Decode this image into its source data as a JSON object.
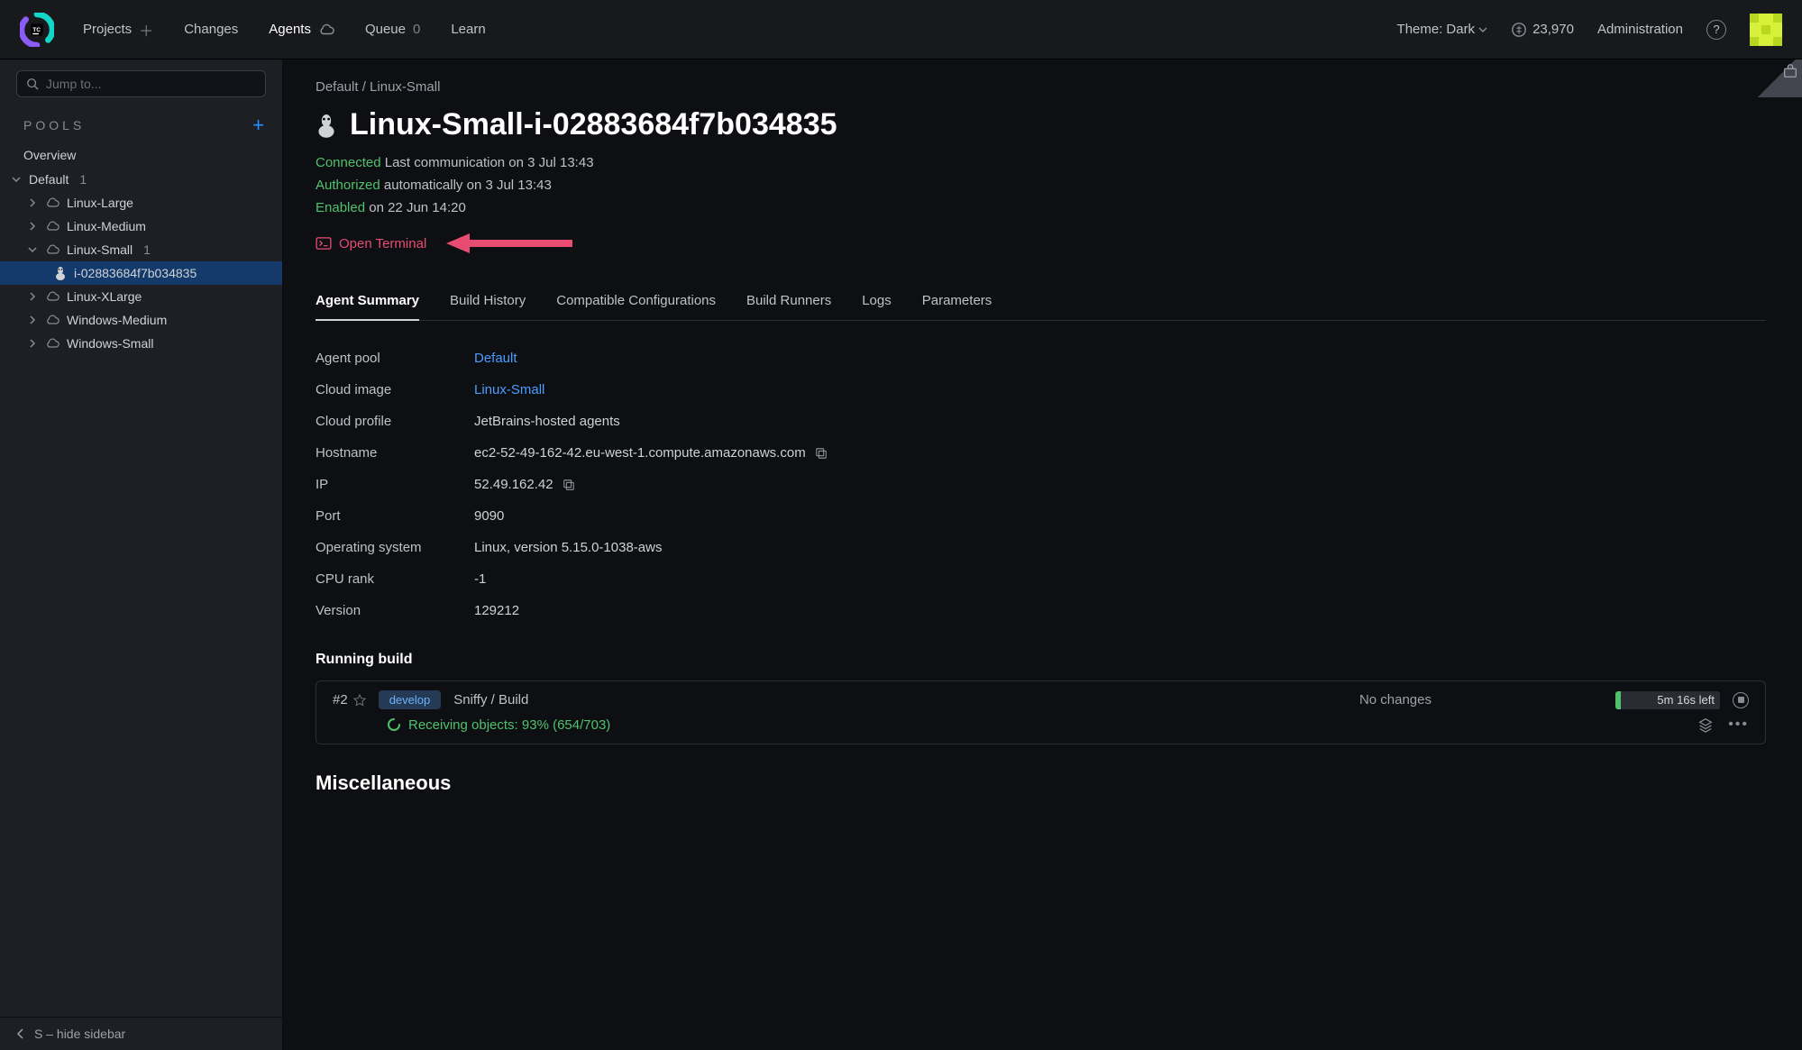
{
  "header": {
    "nav": {
      "projects": "Projects",
      "changes": "Changes",
      "agents": "Agents",
      "queue": "Queue",
      "queue_count": "0",
      "learn": "Learn"
    },
    "theme_label": "Theme:",
    "theme_value": "Dark",
    "credits": "23,970",
    "administration": "Administration"
  },
  "sidebar": {
    "search_placeholder": "Jump to...",
    "pools_label": "POOLS",
    "overview": "Overview",
    "hide_hint": "S – hide sidebar",
    "default_label": "Default",
    "default_count": "1",
    "items": [
      {
        "label": "Linux-Large"
      },
      {
        "label": "Linux-Medium"
      },
      {
        "label": "Linux-Small",
        "count": "1"
      },
      {
        "label": "Linux-XLarge"
      },
      {
        "label": "Windows-Medium"
      },
      {
        "label": "Windows-Small"
      }
    ],
    "selected_agent": "i-02883684f7b034835"
  },
  "breadcrumb": {
    "root": "Default",
    "sep": "/",
    "leaf": "Linux-Small"
  },
  "page_title": "Linux-Small-i-02883684f7b034835",
  "status": {
    "connected_label": "Connected",
    "connected_text": "Last communication on 3 Jul 13:43",
    "authorized_label": "Authorized",
    "authorized_text": "automatically on 3 Jul 13:43",
    "enabled_label": "Enabled",
    "enabled_text": "on 22 Jun 14:20"
  },
  "open_terminal": "Open Terminal",
  "tabs": {
    "summary": "Agent Summary",
    "history": "Build History",
    "compat": "Compatible Configurations",
    "runners": "Build Runners",
    "logs": "Logs",
    "params": "Parameters"
  },
  "props": {
    "pool_label": "Agent pool",
    "pool_value": "Default",
    "image_label": "Cloud image",
    "image_value": "Linux-Small",
    "profile_label": "Cloud profile",
    "profile_value": "JetBrains-hosted agents",
    "host_label": "Hostname",
    "host_value": "ec2-52-49-162-42.eu-west-1.compute.amazonaws.com",
    "ip_label": "IP",
    "ip_value": "52.49.162.42",
    "port_label": "Port",
    "port_value": "9090",
    "os_label": "Operating system",
    "os_value": "Linux, version 5.15.0-1038-aws",
    "cpu_label": "CPU rank",
    "cpu_value": "-1",
    "ver_label": "Version",
    "ver_value": "129212"
  },
  "running_title": "Running build",
  "build": {
    "number": "#2",
    "branch": "develop",
    "project": "Sniffy",
    "sep": "/",
    "config": "Build",
    "no_changes": "No changes",
    "time_left": "5m 16s left",
    "progress_text": "Receiving objects: 93% (654/703)"
  },
  "misc_title": "Miscellaneous"
}
